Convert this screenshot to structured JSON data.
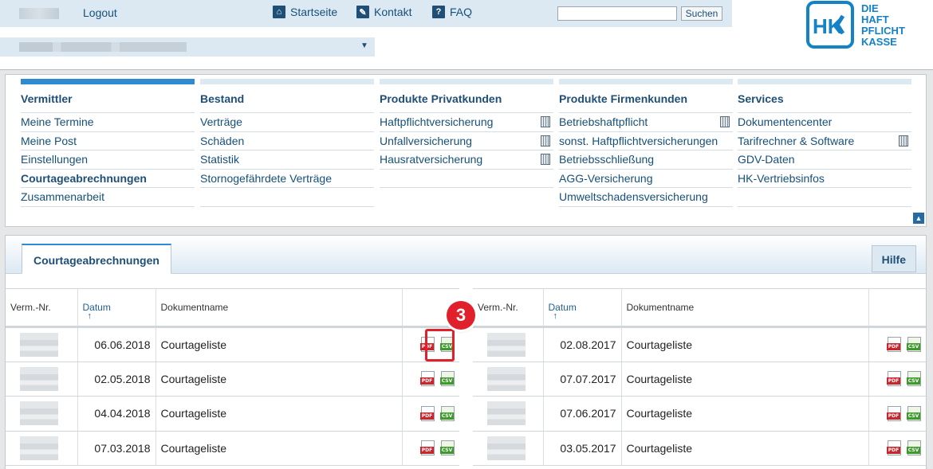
{
  "header": {
    "logout": "Logout",
    "links": [
      {
        "label": "Startseite",
        "icon": "home-icon"
      },
      {
        "label": "Kontakt",
        "icon": "pencil-icon"
      },
      {
        "label": "FAQ",
        "icon": "help-icon"
      }
    ],
    "search_placeholder": "",
    "search_button": "Suchen",
    "logo": {
      "mark": "HK",
      "line1": "DIE",
      "line2": "HAFT",
      "line3": "PFLICHT",
      "line4": "KASSE",
      "color": "#1482c6"
    }
  },
  "menu": {
    "columns": [
      {
        "title": "Vermittler",
        "items": [
          "Meine Termine",
          "Meine Post",
          "Einstellungen",
          "Courtageabrechnungen",
          "Zusammenarbeit"
        ]
      },
      {
        "title": "Bestand",
        "items": [
          "Verträge",
          "Schäden",
          "Statistik",
          "Stornogefährdete Verträge"
        ]
      },
      {
        "title": "Produkte Privatkunden",
        "items": [
          "Haftpflichtversicherung",
          "Unfallversicherung",
          "Hausratversicherung"
        ]
      },
      {
        "title": "Produkte Firmenkunden",
        "items": [
          "Betriebshaftpflicht",
          "sonst. Haftpflichtversicherungen",
          "Betriebsschließung",
          "AGG-Versicherung",
          "Umweltschadensversicherung"
        ]
      },
      {
        "title": "Services",
        "items": [
          "Dokumentencenter",
          "Tarifrechner & Software",
          "GDV-Daten",
          "HK-Vertriebsinfos"
        ]
      }
    ]
  },
  "panel": {
    "tab": "Courtageabrechnungen",
    "help": "Hilfe",
    "columns": {
      "vnr": "Verm.-Nr.",
      "datum": "Datum",
      "name": "Dokumentname"
    },
    "left_rows": [
      {
        "date": "06.06.2018",
        "name": "Courtageliste"
      },
      {
        "date": "02.05.2018",
        "name": "Courtageliste"
      },
      {
        "date": "04.04.2018",
        "name": "Courtageliste"
      },
      {
        "date": "07.03.2018",
        "name": "Courtageliste"
      }
    ],
    "right_rows": [
      {
        "date": "02.08.2017",
        "name": "Courtageliste"
      },
      {
        "date": "07.07.2017",
        "name": "Courtageliste"
      },
      {
        "date": "07.06.2017",
        "name": "Courtageliste"
      },
      {
        "date": "03.05.2017",
        "name": "Courtageliste"
      }
    ],
    "pdf_label": "PDF",
    "csv_label": "CSV"
  },
  "annotation": {
    "step": "3",
    "color": "#e0202a"
  }
}
